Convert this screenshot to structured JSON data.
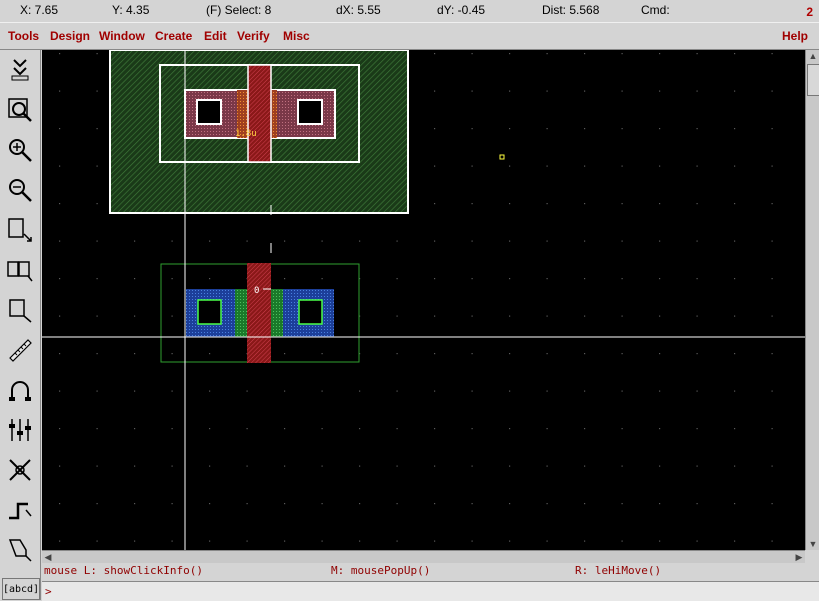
{
  "status": {
    "x": "X:  7.65",
    "y": "Y:  4.35",
    "select": "(F) Select: 8",
    "dx": "dX:  5.55",
    "dy": "dY:  -0.45",
    "dist": "Dist:  5.568",
    "cmd": "Cmd:",
    "window_num": "2"
  },
  "menu": {
    "tools": "Tools",
    "design": "Design",
    "window": "Window",
    "create": "Create",
    "edit": "Edit",
    "verify": "Verify",
    "misc": "Misc",
    "help": "Help"
  },
  "toolbar": {
    "icons": [
      "save-icon",
      "fit-icon",
      "zoom-in-icon",
      "zoom-out-icon",
      "stretch-icon",
      "copy-icon",
      "move-icon",
      "ruler-icon",
      "undo-icon",
      "property-icon",
      "delete-icon",
      "path-icon",
      "polygon-icon"
    ],
    "label_tool": "[abcd]"
  },
  "canvas": {
    "label_top": "1.8u",
    "label_bottom": "0"
  },
  "mouse": {
    "left": "mouse L: showClickInfo()",
    "middle": "M: mousePopUp()",
    "right": "R: leHiMove()"
  },
  "cmdline": {
    "prompt": ">"
  },
  "colors": {
    "menu_text": "#a00000",
    "canvas_bg": "#000000",
    "nwell": "#1e5a1e",
    "poly": "#c0202a",
    "diffusion": "#2050b0"
  }
}
